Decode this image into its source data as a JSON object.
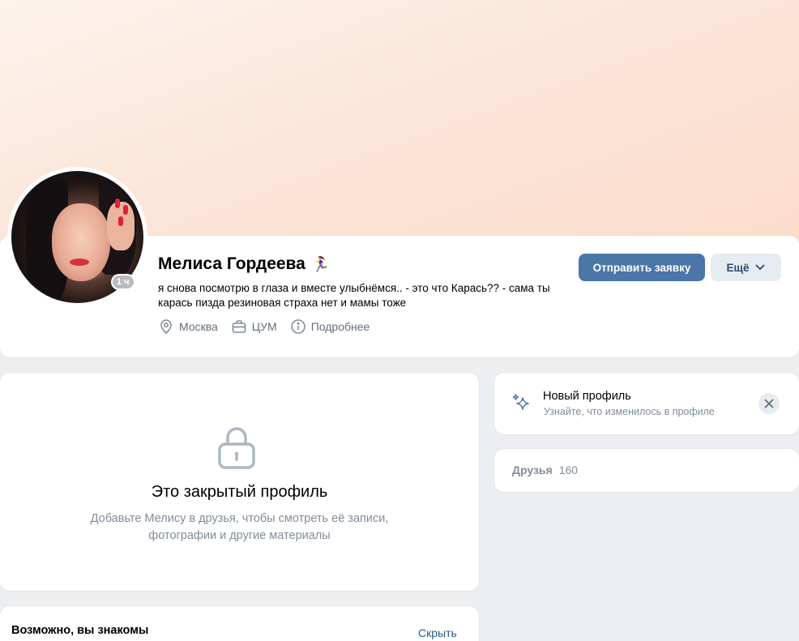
{
  "profile": {
    "name": "Мелиса Гордеева",
    "emoji": "🏃‍♀️",
    "status": "я снова посмотрю в глаза и вместе улыбнёмся.. - это что Карась?? - сама ты карась пизда резиновая страха нет и мамы тоже",
    "online": "1 ч",
    "meta": {
      "city": "Москва",
      "work": "ЦУМ",
      "details": "Подробнее"
    }
  },
  "actions": {
    "send_request": "Отправить заявку",
    "more": "Ещё"
  },
  "closed": {
    "title": "Это закрытый профиль",
    "text": "Добавьте Мелису в друзья, чтобы смотреть её записи, фотографии и другие материалы"
  },
  "new_profile": {
    "title": "Новый профиль",
    "subtitle": "Узнайте, что изменилось в профиле"
  },
  "friends": {
    "label": "Друзья",
    "count": "160"
  },
  "maybe_know": {
    "title": "Возможно, вы знакомы",
    "hide": "Скрыть"
  },
  "colors": {
    "accent": "#4a76a8",
    "secondary_button": "#e5ebf1",
    "muted_text": "#818c99",
    "link": "#2a5885"
  }
}
